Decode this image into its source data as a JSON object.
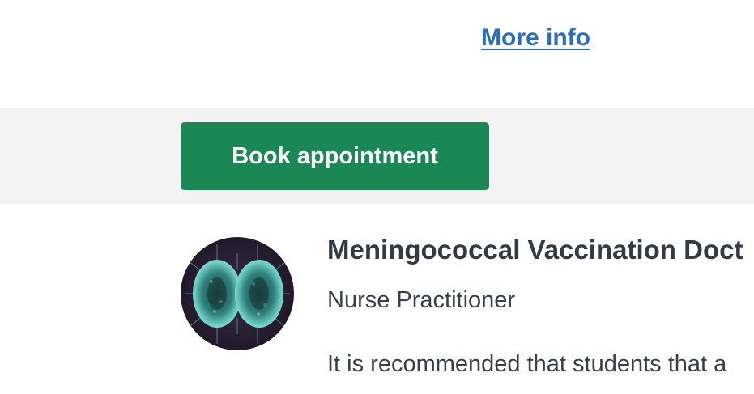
{
  "links": {
    "more_info": "More info"
  },
  "actions": {
    "book_appointment": "Book appointment"
  },
  "service": {
    "title": "Meningococcal Vaccination Doct",
    "provider_role": "Nurse Practitioner",
    "description": "It is recommended that students that a"
  },
  "colors": {
    "link": "#2a6ebb",
    "button_bg": "#1b8754",
    "band_bg": "#f3f3f3",
    "text": "#333a44"
  },
  "images": {
    "service_avatar": "bacteria-illustration"
  }
}
